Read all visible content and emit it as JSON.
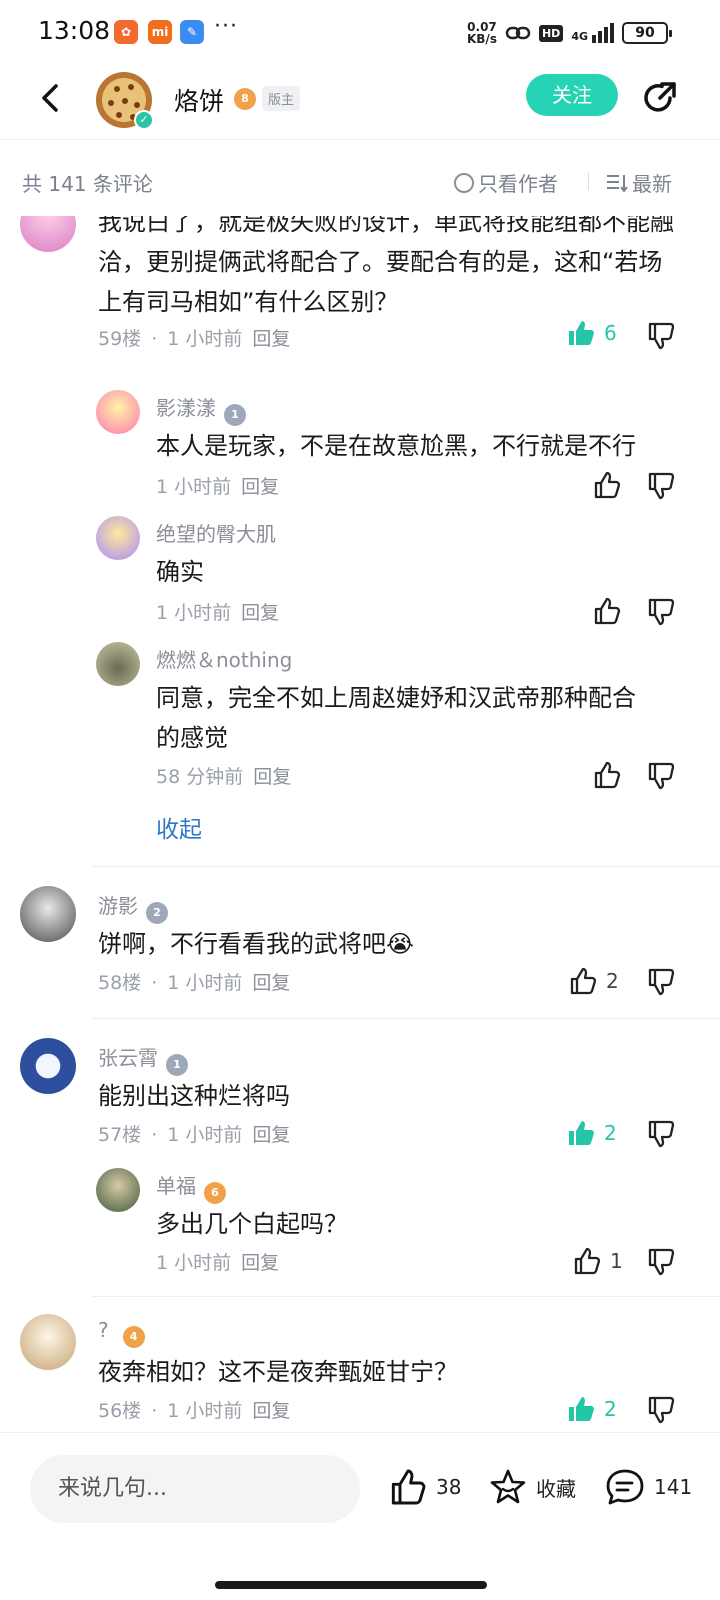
{
  "status_bar": {
    "time": "13:08",
    "dots": "···",
    "net_speed_value": "0.07",
    "net_speed_unit": "KB/s",
    "hd": "HD",
    "network": "4G",
    "battery": "90",
    "app_icons": [
      "xiaohongshu-icon",
      "mi-icon",
      "notes-icon"
    ]
  },
  "header": {
    "author_name": "烙饼",
    "author_level": "8",
    "mod_tag": "版主",
    "follow_label": "关注"
  },
  "filter": {
    "count_text": "共 141 条评论",
    "only_author_label": "只看作者",
    "sort_label": "最新"
  },
  "comments": [
    {
      "text": "我说白了，就是极失败的设计，单武将技能组都不能融洽，更别提俩武将配合了。要配合有的是，这和“若场上有司马相如”有什么区别？",
      "floor": "59楼",
      "time": "1 小时前",
      "reply": "回复",
      "likes": "6",
      "liked": true
    },
    {
      "name": "影漾漾",
      "level": "1",
      "text": "本人是玩家，不是在故意尬黑，不行就是不行",
      "time": "1 小时前",
      "reply": "回复",
      "likes": ""
    },
    {
      "name": "绝望的臀大肌",
      "level": "",
      "text": "确实",
      "time": "1 小时前",
      "reply": "回复",
      "likes": ""
    },
    {
      "name": "燃燃＆nothing",
      "level": "",
      "text_line1": "同意，完全不如上周赵婕妤和汉武帝那种配合",
      "text_line2": "的感觉",
      "time": "58 分钟前",
      "reply": "回复",
      "likes": ""
    },
    {
      "name": "游影",
      "level": "2",
      "text": "饼啊，不行看看我的武将吧😭",
      "floor": "58楼",
      "time": "1 小时前",
      "reply": "回复",
      "likes": "2"
    },
    {
      "name": "张云霄",
      "level": "1",
      "text": "能别出这种烂将吗",
      "floor": "57楼",
      "time": "1 小时前",
      "reply": "回复",
      "likes": "2",
      "liked": true
    },
    {
      "name": "单福",
      "level": "6",
      "text": "多出几个白起吗？",
      "time": "1 小时前",
      "reply": "回复",
      "likes": "1"
    },
    {
      "name": "?",
      "level": "4",
      "text": "夜奔相如？这不是夜奔甄姬甘宁？",
      "floor": "56楼",
      "time": "1 小时前",
      "reply": "回复",
      "likes": "2",
      "liked": true
    }
  ],
  "collapse_label": "收起",
  "bottom_bar": {
    "input_placeholder": "来说几句...",
    "like_count": "38",
    "favorite_label": "收藏",
    "comment_count": "141"
  },
  "colors": {
    "accent": "#26d3b4",
    "link": "#2a79c9",
    "level_orange": "#f0a24a",
    "level_gray": "#9fa8b8"
  }
}
